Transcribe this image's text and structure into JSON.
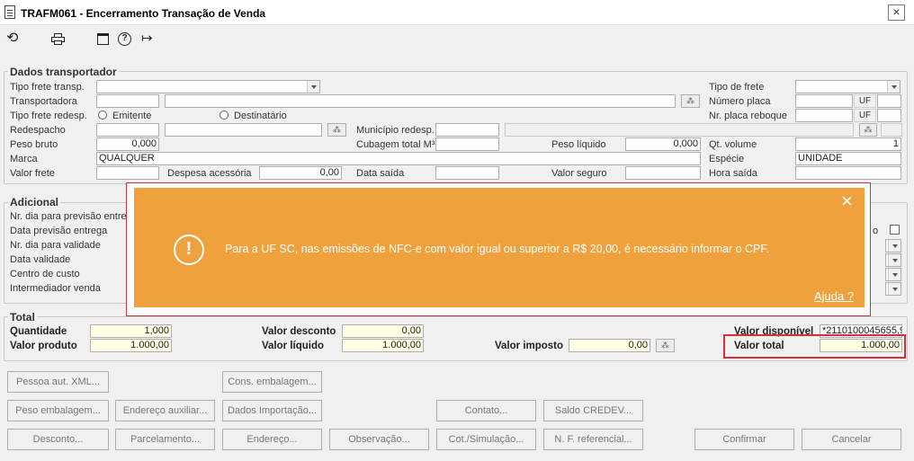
{
  "window": {
    "title": "TRAFM061 - Encerramento Transação de Venda",
    "close_symbol": "×"
  },
  "toolbar": {
    "icons": [
      "undo-icon",
      "print-icon",
      "calendar-icon",
      "help-icon",
      "exit-icon"
    ],
    "undo": "⟲",
    "help": "?",
    "exit": "↦"
  },
  "transportador": {
    "title": "Dados transportador",
    "tipo_frete_transp_label": "Tipo frete transp.",
    "transportadora_label": "Transportadora",
    "tipo_frete_redesp_label": "Tipo frete redesp.",
    "emitente_label": "Emitente",
    "destinatario_label": "Destinatário",
    "redespacho_label": "Redespacho",
    "municipio_redesp_label": "Município redesp.",
    "peso_bruto_label": "Peso bruto",
    "peso_bruto_value": "0,000",
    "cubagem_label": "Cubagem total M³",
    "peso_liquido_label": "Peso líquido",
    "peso_liquido_value": "0,000",
    "marca_label": "Marca",
    "marca_value": "QUALQUER",
    "valor_frete_label": "Valor frete",
    "despesa_label": "Despesa acessória",
    "despesa_value": "0,00",
    "data_saida_label": "Data saída",
    "valor_seguro_label": "Valor seguro",
    "tipo_frete_label": "Tipo de frete",
    "numero_placa_label": "Número placa",
    "placa_reboque_label": "Nr. placa reboque",
    "uf_label": "UF",
    "qt_volume_label": "Qt. volume",
    "qt_volume_value": "1",
    "especie_label": "Espécie",
    "especie_value": "UNIDADE",
    "hora_saida_label": "Hora saída"
  },
  "adicional": {
    "title": "Adicional",
    "labels": [
      "Nr. dia para previsão entrega",
      "Data previsão entrega",
      "Nr. dia para validade",
      "Data validade",
      "Centro de custo",
      "Intermediador venda"
    ],
    "right_fragment": "o"
  },
  "total": {
    "title": "Total",
    "quantidade_label": "Quantidade",
    "quantidade_value": "1,000",
    "valor_produto_label": "Valor produto",
    "valor_produto_value": "1.000,00",
    "valor_desconto_label": "Valor desconto",
    "valor_desconto_value": "0,00",
    "valor_liquido_label": "Valor líquido",
    "valor_liquido_value": "1.000,00",
    "valor_imposto_label": "Valor imposto",
    "valor_imposto_value": "0,00",
    "valor_disponivel_label": "Valor disponível",
    "valor_disponivel_value": "*2110100045655,9",
    "valor_total_label": "Valor total",
    "valor_total_value": "1.000,00"
  },
  "buttons": {
    "pessoa_xml": "Pessoa aut. XML...",
    "cons_embalagem": "Cons. embalagem...",
    "peso_embalagem": "Peso embalagem...",
    "endereco_auxiliar": "Endereço auxiliar...",
    "dados_importacao": "Dados Importação...",
    "contato": "Contato...",
    "saldo_credev": "Saldo CREDEV...",
    "desconto": "Desconto...",
    "parcelamento": "Parcelamento...",
    "endereco": "Endereço...",
    "observacao": "Observação...",
    "cot_simulacao": "Cot./Simulação...",
    "nf_referencial": "N. F. referencial...",
    "confirmar": "Confirmar",
    "cancelar": "Cancelar"
  },
  "alert": {
    "message": "Para a UF SC, nas emissões de NFC-e com valor igual ou superior a R$ 20,00, é necessário informar o CPF.",
    "help_link": "Ajuda ?",
    "icon": "!",
    "close": "×",
    "color": "#efa13e"
  },
  "search_button_symbol": "⁂"
}
